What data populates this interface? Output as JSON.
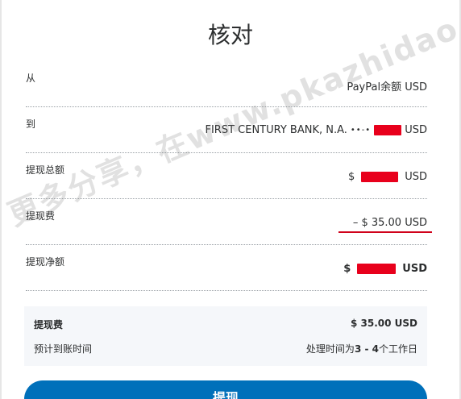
{
  "title": "核对",
  "rows": {
    "from": {
      "label": "从",
      "value": "PayPal余额 USD"
    },
    "to": {
      "label": "到",
      "bank": "FIRST CENTURY BANK, N.A.",
      "mask": "••-•",
      "currency": "USD"
    },
    "total": {
      "label": "提现总额",
      "prefix": "$",
      "currency": "USD"
    },
    "fee": {
      "label": "提现费",
      "value": "– $ 35.00 USD"
    },
    "net": {
      "label": "提现净额",
      "prefix": "$",
      "currency": "USD"
    }
  },
  "summary": {
    "fee_label": "提现费",
    "fee_value": "$ 35.00 USD",
    "eta_label": "预计到账时间",
    "eta_prefix": "处理时间为",
    "eta_range": "3 - 4",
    "eta_suffix": "个工作日"
  },
  "submit_label": "提现",
  "watermark": "更多分享，在www.pkazhidao.com",
  "colors": {
    "accent": "#0070ba",
    "fee_underline": "#d0021b",
    "redaction": "#e8001c"
  }
}
